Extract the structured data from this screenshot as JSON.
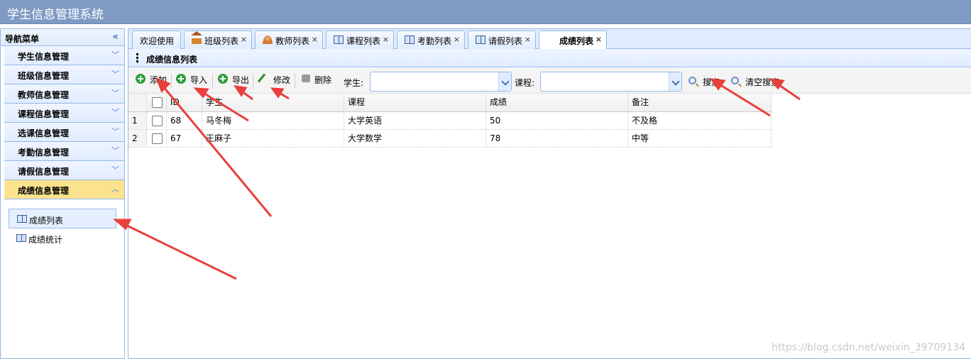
{
  "app": {
    "title": "学生信息管理系统"
  },
  "sidebar": {
    "header": "导航菜单",
    "collapse_icon": "«",
    "menu": [
      {
        "label": "学生信息管理"
      },
      {
        "label": "班级信息管理"
      },
      {
        "label": "教师信息管理"
      },
      {
        "label": "课程信息管理"
      },
      {
        "label": "选课信息管理"
      },
      {
        "label": "考勤信息管理"
      },
      {
        "label": "请假信息管理"
      },
      {
        "label": "成绩信息管理"
      }
    ],
    "submenu": [
      {
        "label": "成绩列表"
      },
      {
        "label": "成绩统计"
      }
    ]
  },
  "tabs": [
    {
      "label": "欢迎使用"
    },
    {
      "label": "班级列表",
      "icon": "house-icon"
    },
    {
      "label": "教师列表",
      "icon": "person-icon"
    },
    {
      "label": "课程列表",
      "icon": "book-icon"
    },
    {
      "label": "考勤列表",
      "icon": "book-icon"
    },
    {
      "label": "请假列表",
      "icon": "book-icon"
    },
    {
      "label": "成绩列表"
    }
  ],
  "panel": {
    "title": "成绩信息列表"
  },
  "toolbar": {
    "add": "添加",
    "import": "导入",
    "export": "导出",
    "edit": "修改",
    "delete": "删除",
    "student_label": "学生:",
    "course_label": "课程:",
    "student_value": "",
    "course_value": "",
    "search": "搜索",
    "clear_search": "清空搜索"
  },
  "table": {
    "columns": [
      "ID",
      "学生",
      "课程",
      "成绩",
      "备注"
    ],
    "rows": [
      {
        "num": "1",
        "id": "68",
        "student": "马冬梅",
        "course": "大学英语",
        "score": "50",
        "note": "不及格"
      },
      {
        "num": "2",
        "id": "67",
        "student": "王麻子",
        "course": "大学数学",
        "score": "78",
        "note": "中等"
      }
    ]
  },
  "watermark": "https://blog.csdn.net/weixin_39709134",
  "colors": {
    "header_bg": "#7f9bc4",
    "border": "#95b8e7",
    "active_menu": "#fbe38e",
    "annotation_arrow": "#e8403c"
  }
}
